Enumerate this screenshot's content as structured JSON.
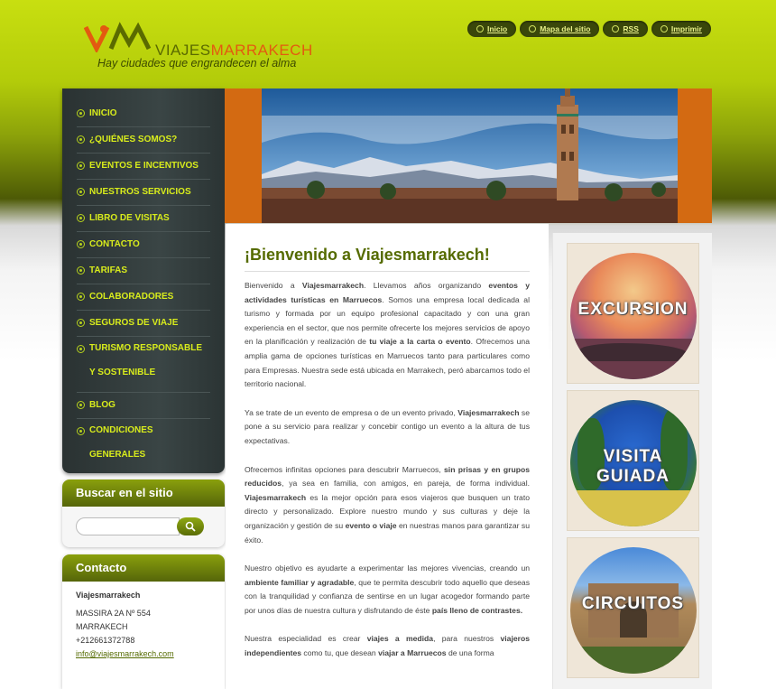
{
  "header": {
    "logo_part1": "VIAJES",
    "logo_part2": "MARRAKECH",
    "tagline": "Hay ciudades que engrandecen el alma",
    "nav": [
      {
        "label": "Inicio",
        "icon": "home-icon"
      },
      {
        "label": "Mapa del sitio",
        "icon": "sitemap-icon"
      },
      {
        "label": "RSS",
        "icon": "rss-icon"
      },
      {
        "label": "Imprimir",
        "icon": "print-icon"
      }
    ]
  },
  "menu": [
    {
      "label": "INICIO"
    },
    {
      "label": "¿QUIÉNES SOMOS?"
    },
    {
      "label": "EVENTOS E INCENTIVOS"
    },
    {
      "label": "NUESTROS SERVICIOS"
    },
    {
      "label": "LIBRO DE VISITAS"
    },
    {
      "label": "CONTACTO"
    },
    {
      "label": "TARIFAS"
    },
    {
      "label": "COLABORADORES"
    },
    {
      "label": "SEGUROS DE VIAJE"
    },
    {
      "label": "TURISMO RESPONSABLE Y SOSTENIBLE"
    },
    {
      "label": "BLOG"
    },
    {
      "label": "CONDICIONES GENERALES"
    }
  ],
  "search": {
    "title": "Buscar en el sitio",
    "placeholder": ""
  },
  "contact": {
    "title": "Contacto",
    "name": "Viajesmarrakech",
    "address1": "MASSIRA 2A Nº 554",
    "address2": "MARRAKECH",
    "phone": "+212661372788",
    "email": "info@viajesmarrakech.com"
  },
  "main": {
    "title": "¡Bienvenido a Viajesmarrakech!",
    "p1": [
      {
        "t": "Bienvenido a "
      },
      {
        "t": "Viajesmarrakech",
        "b": true
      },
      {
        "t": ". Llevamos años organizando "
      },
      {
        "t": "eventos y actividades turísticas en Marruecos",
        "b": true
      },
      {
        "t": ". Somos una empresa local dedicada al turismo y formada por un equipo profesional capacitado y con una gran experiencia en el sector, que nos permite ofrecerte los mejores servicios de apoyo en la planificación y realización de "
      },
      {
        "t": "tu viaje a la carta o evento",
        "b": true
      },
      {
        "t": ". Ofrecemos una amplia gama de opciones turísticas en Marruecos tanto para particulares como para Empresas. Nuestra sede está ubicada en Marrakech, peró abarcamos todo el territorio nacional."
      }
    ],
    "p2": [
      {
        "t": "Ya se trate de un evento de empresa o de un evento privado, "
      },
      {
        "t": "Viajesmarrakech",
        "b": true
      },
      {
        "t": " se pone a su servicio para realizar y concebir contigo un evento a la altura de tus expectativas."
      }
    ],
    "p3": [
      {
        "t": "Ofrecemos infinitas opciones para descubrir Marruecos, "
      },
      {
        "t": "sin prisas y en grupos reducidos",
        "b": true
      },
      {
        "t": ", ya sea en familia, con amigos, en pareja, de forma individual. "
      },
      {
        "t": "Viajesmarrakech",
        "b": true
      },
      {
        "t": " es la mejor opción para esos viajeros que busquen un trato directo y personalizado. Explore nuestro mundo y sus culturas y deje la organización y gestión de su "
      },
      {
        "t": "evento o viaje",
        "b": true
      },
      {
        "t": " en nuestras manos para garantizar su éxito."
      }
    ],
    "p4": [
      {
        "t": "Nuestro objetivo es ayudarte a experimentar las mejores vivencias, creando un "
      },
      {
        "t": "ambiente familiar y agradable",
        "b": true
      },
      {
        "t": ", que te permita descubrir todo aquello que deseas con la tranquilidad y confianza de sentirse en un lugar acogedor formando parte por unos días de nuestra cultura y disfrutando de éste "
      },
      {
        "t": "país lleno de contrastes.",
        "b": true
      }
    ],
    "p5": [
      {
        "t": "Nuestra especialidad es crear "
      },
      {
        "t": "viajes a medida",
        "b": true
      },
      {
        "t": ",  para nuestros "
      },
      {
        "t": "viajeros independientes",
        "b": true
      },
      {
        "t": " como tu, que desean "
      },
      {
        "t": "viajar a Marruecos",
        "b": true
      },
      {
        "t": " de una forma"
      }
    ]
  },
  "tiles": [
    {
      "label": "EXCURSION"
    },
    {
      "label": "VISITA",
      "label2": "GUIADA"
    },
    {
      "label": "CIRCUITOS"
    }
  ],
  "colors": {
    "accent": "#c8df10",
    "menu_text": "#d8ec1c",
    "title": "#556b00",
    "banner": "#d36a12"
  }
}
